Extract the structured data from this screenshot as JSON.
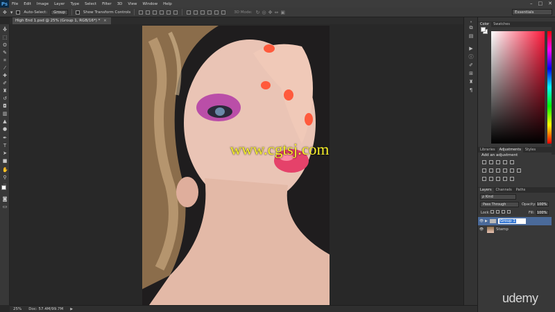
{
  "app": {
    "logo": "Ps"
  },
  "menu": [
    "File",
    "Edit",
    "Image",
    "Layer",
    "Type",
    "Select",
    "Filter",
    "3D",
    "View",
    "Window",
    "Help"
  ],
  "window_controls": [
    "–",
    "□",
    "✕"
  ],
  "options_bar": {
    "auto_select_label": "Auto-Select:",
    "auto_select_value": "Group",
    "show_transform_label": "Show Transform Controls",
    "mode_3d_label": "3D Mode:",
    "workspace": "Essentials"
  },
  "document": {
    "tab_title": "High End 1.psd @ 25% (Group 1, RGB/16*) *",
    "tab_close": "×",
    "zoom": "25%",
    "doc_size": "Doc: 57.4M/99.7M"
  },
  "watermark": "www.cgtsj.com",
  "panels": {
    "color_tabs": [
      "Color",
      "Swatches"
    ],
    "adjust_tabs": [
      "Libraries",
      "Adjustments",
      "Styles"
    ],
    "adjust_title": "Add an adjustment",
    "layer_tabs": [
      "Layers",
      "Channels",
      "Paths"
    ],
    "filter_kind": "ρ Kind",
    "blend_mode": "Pass Through",
    "opacity_label": "Opacity:",
    "opacity_value": "100%",
    "lock_label": "Lock:",
    "fill_label": "Fill:",
    "fill_value": "100%"
  },
  "layers": [
    {
      "name": "Group 1",
      "type": "group",
      "selected": true
    },
    {
      "name": "Stamp",
      "type": "image",
      "selected": false
    }
  ],
  "branding": "udemy",
  "colors": {
    "accent_selection": "#4a6a9a",
    "watermark": "#f7ef2a",
    "picker_hue": "#ff1a3c"
  }
}
